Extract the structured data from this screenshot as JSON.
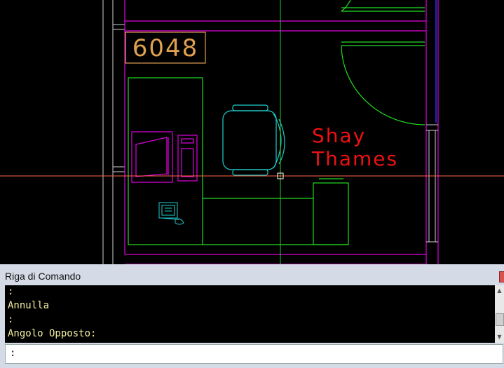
{
  "drawing": {
    "room_number": "6048",
    "occupant_first": "Shay",
    "occupant_last": "Thames"
  },
  "command_panel": {
    "title": "Riga di Comando",
    "history": [
      ":",
      "Annulla",
      ":",
      "Angolo Opposto:"
    ],
    "prompt": ":"
  },
  "colors": {
    "background": "#000000",
    "wall": "#e000e0",
    "furniture_green": "#22dd22",
    "chair_cyan": "#22cccc",
    "label_red": "#ee1111",
    "room_tag": "#e0a050",
    "crosshair_vertical": "#22cc22",
    "crosshair_horizontal": "#ff6644",
    "history_text": "#f5f0a0"
  }
}
